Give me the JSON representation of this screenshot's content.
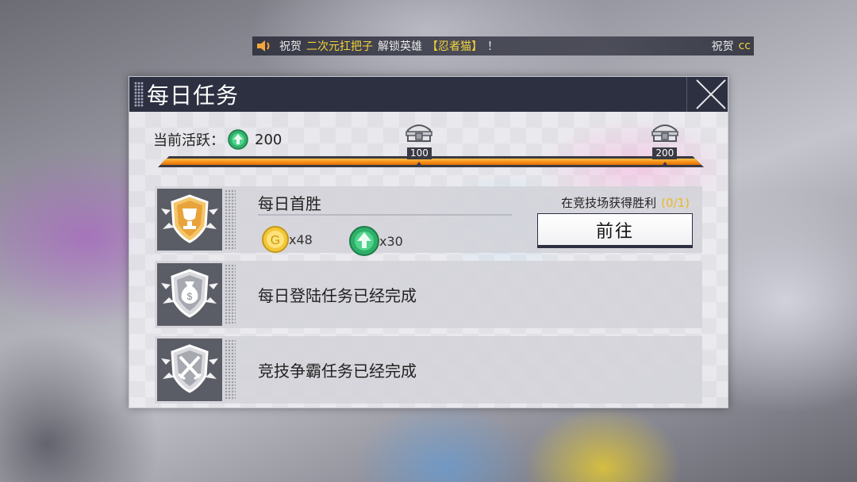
{
  "marquee": {
    "prefix": "祝贺",
    "player": "二次元扛把子",
    "action": "解锁英雄",
    "hero": "【忍者猫】",
    "exclaim": "！",
    "next_prefix": "祝贺",
    "next_player": "cc"
  },
  "dialog": {
    "title": "每日任务"
  },
  "activity": {
    "label": "当前活跃：",
    "value": "200",
    "progress": 1.0,
    "max": 200,
    "milestones": [
      {
        "value": 100,
        "label": "100"
      },
      {
        "value": 200,
        "label": "200"
      }
    ]
  },
  "tasks": [
    {
      "title": "每日首胜",
      "requirement": "在竞技场获得胜利",
      "progress": "(0/1)",
      "button": "前往",
      "rewards": [
        {
          "icon": "gold-coin-icon",
          "amount": "x48"
        },
        {
          "icon": "activity-gem-icon",
          "amount": "x30"
        }
      ]
    },
    {
      "title": "每日登陆任务已经完成"
    },
    {
      "title": "竞技争霸任务已经完成"
    }
  ],
  "colors": {
    "header": "#2d3040",
    "progress_fill": "#f58a12",
    "highlight": "#f4d33a",
    "trophy_gold": "#e8a33a"
  }
}
